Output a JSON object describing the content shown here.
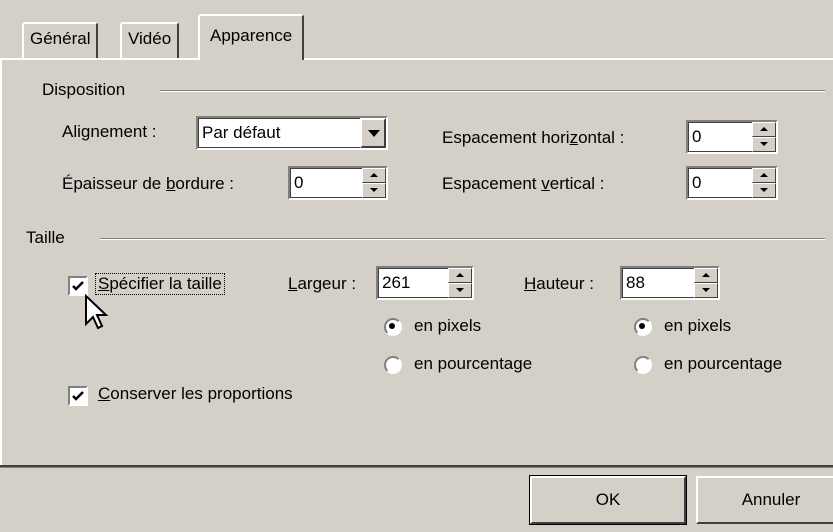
{
  "tabs": [
    {
      "label": "Général",
      "active": false
    },
    {
      "label": "Vidéo",
      "active": false
    },
    {
      "label": "Apparence",
      "active": true
    }
  ],
  "disposition": {
    "title": "Disposition",
    "alignement_label_a": "Ali",
    "alignement_label_u": "g",
    "alignement_label_b": "nement :",
    "alignement_value": "Par défaut",
    "bordure_label_a": "Épaisseur de ",
    "bordure_label_u": "b",
    "bordure_label_b": "ordure :",
    "bordure_value": "0",
    "esp_h_label_a": "Espacement hori",
    "esp_h_label_u": "z",
    "esp_h_label_b": "ontal :",
    "esp_h_value": "0",
    "esp_v_label_a": "Espacement ",
    "esp_v_label_u": "v",
    "esp_v_label_b": "ertical :",
    "esp_v_value": "0"
  },
  "taille": {
    "title": "Taille",
    "specifier_u": "S",
    "specifier_rest": "pécifier la taille",
    "specifier_checked": true,
    "largeur_u": "L",
    "largeur_rest": "argeur :",
    "largeur_value": "261",
    "hauteur_u": "H",
    "hauteur_rest": "auteur :",
    "hauteur_value": "88",
    "unit_pixels": "en pixels",
    "unit_pourcentage": "en pourcentage",
    "conserver_u": "C",
    "conserver_rest": "onserver les proportions",
    "conserver_checked": true
  },
  "buttons": {
    "ok": "OK",
    "annuler": "Annuler"
  }
}
